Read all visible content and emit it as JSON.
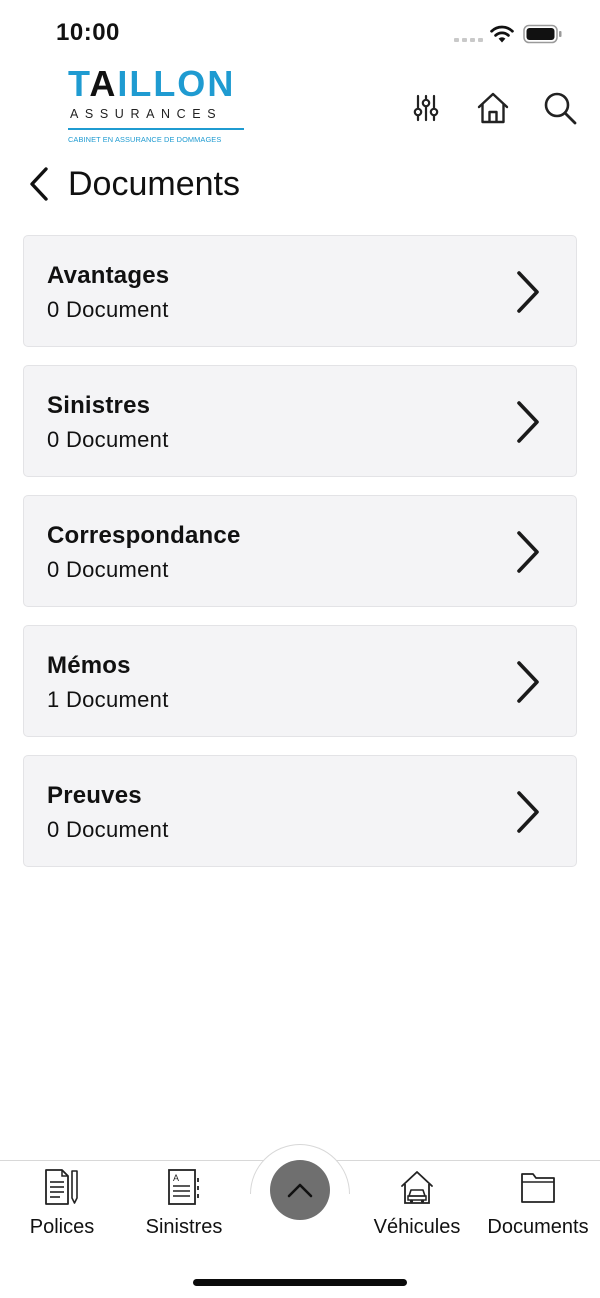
{
  "status_bar": {
    "time": "10:00"
  },
  "header": {
    "logo": {
      "main_pre": "T",
      "main_a": "A",
      "main_post": "ILLON",
      "sub": "ASSURANCES",
      "tagline": "CABINET EN ASSURANCE DE DOMMAGES"
    },
    "icons": [
      "filter-sliders-icon",
      "home-icon",
      "search-icon"
    ]
  },
  "page": {
    "title": "Documents"
  },
  "documents": [
    {
      "name": "Avantages",
      "count": "0 Document"
    },
    {
      "name": "Sinistres",
      "count": "0 Document"
    },
    {
      "name": "Correspondance",
      "count": "0 Document"
    },
    {
      "name": "Mémos",
      "count": "1 Document"
    },
    {
      "name": "Preuves",
      "count": "0 Document"
    }
  ],
  "tabbar": {
    "polices": "Polices",
    "sinistres": "Sinistres",
    "vehicules": "Véhicules",
    "documents": "Documents"
  },
  "colors": {
    "brand": "#1f9bd1",
    "card_bg": "#f4f4f6",
    "center_button": "#6f6f6f"
  }
}
